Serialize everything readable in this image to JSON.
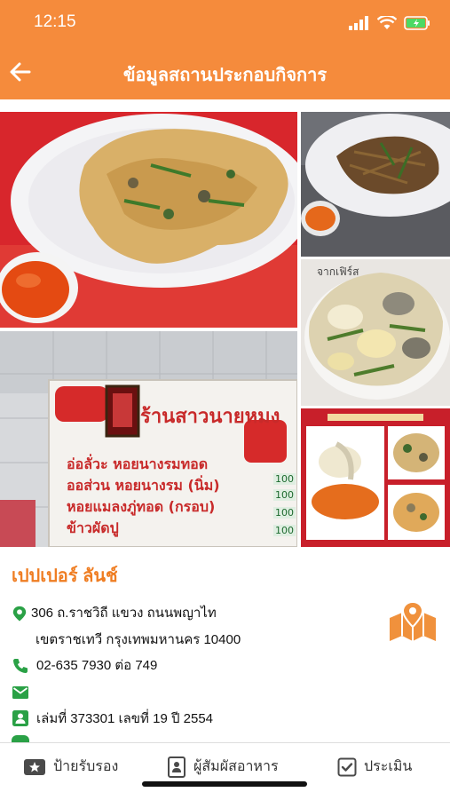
{
  "status": {
    "time": "12:15"
  },
  "header": {
    "title": "ข้อมูลสถานประกอบกิจการ"
  },
  "gallery": {
    "sign_lines": [
      "อ่อลั่วะ  หอยนางรมทอด",
      "ออส่วน  หอยนางรม (นิ่ม)",
      "หอยแมลงภู่ทอด (กรอบ)",
      "ข้าวผัดปู"
    ],
    "sign_title": "ร้านสาวนายหมง",
    "sign_price": "100"
  },
  "business": {
    "name": "เปปเปอร์ ลันช์",
    "address_line1": "306 ถ.ราชวิถี แขวง ถนนพญาไท",
    "address_line2": "เขตราชเทวี กรุงเทพมหานคร 10400",
    "phone": "02-635 7930 ต่อ 749",
    "email": "",
    "license": "เล่มที่ 373301 เลขที่ 19 ปี 2554"
  },
  "tabs": [
    {
      "label": "ป้ายรับรอง",
      "icon": "star-badge-icon"
    },
    {
      "label": "ผู้สัมผัสอาหาร",
      "icon": "id-card-icon"
    },
    {
      "label": "ประเมิน",
      "icon": "checkbox-icon"
    }
  ],
  "colors": {
    "primary": "#f58b3c",
    "icon_green": "#2aa146",
    "map_orange": "#f0913c"
  }
}
